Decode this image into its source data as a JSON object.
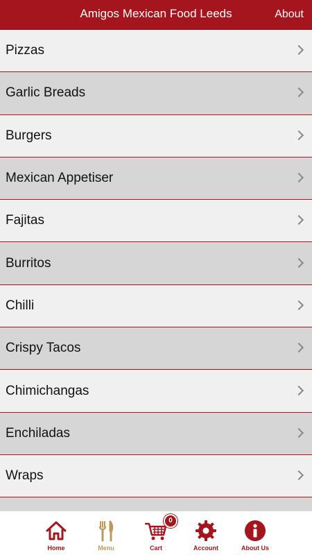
{
  "header": {
    "title": "Amigos Mexican Food Leeds",
    "about_label": "About"
  },
  "menu": {
    "items": [
      {
        "label": "Pizzas"
      },
      {
        "label": "Garlic Breads"
      },
      {
        "label": "Burgers"
      },
      {
        "label": "Mexican Appetiser"
      },
      {
        "label": "Fajitas"
      },
      {
        "label": "Burritos"
      },
      {
        "label": "Chilli"
      },
      {
        "label": "Crispy Tacos"
      },
      {
        "label": "Chimichangas"
      },
      {
        "label": "Enchiladas"
      },
      {
        "label": "Wraps"
      }
    ]
  },
  "tabs": {
    "home": {
      "label": "Home",
      "icon": "home-icon"
    },
    "menu": {
      "label": "Menu",
      "icon": "fork-knife-icon"
    },
    "cart": {
      "label": "Cart",
      "icon": "cart-icon",
      "badge": "0"
    },
    "account": {
      "label": "Account",
      "icon": "gear-icon"
    },
    "about": {
      "label": "About Us",
      "icon": "info-icon"
    }
  },
  "colors": {
    "brand": "#a5151d",
    "active_tab": "#b99a58",
    "row_light": "#f0f0f0",
    "row_dark": "#d6d6d6"
  }
}
